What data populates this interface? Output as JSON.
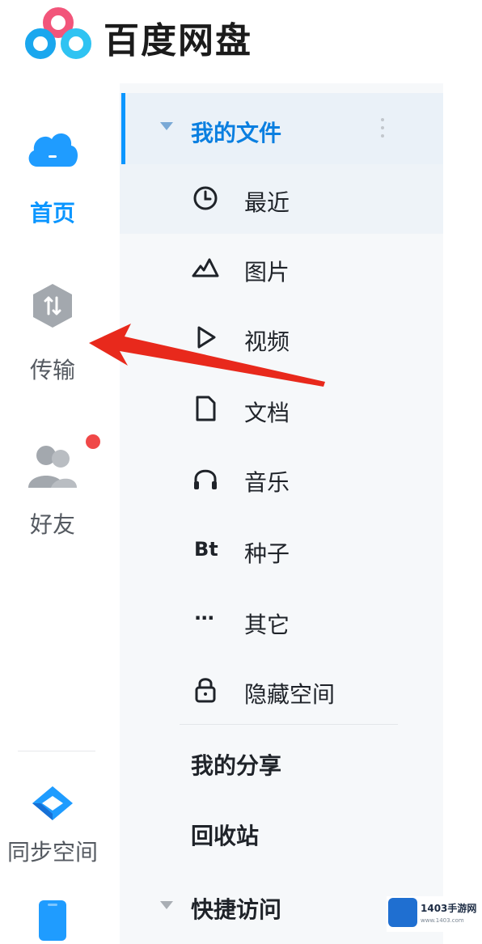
{
  "app": {
    "title": "百度网盘"
  },
  "rail": {
    "items": [
      {
        "label": "首页",
        "icon": "cloud-home-icon",
        "active": true
      },
      {
        "label": "传输",
        "icon": "transfer-icon",
        "active": false
      },
      {
        "label": "好友",
        "icon": "friends-icon",
        "active": false,
        "badge": "red-dot"
      },
      {
        "label": "同步空间",
        "icon": "sync-space-icon",
        "active": false
      },
      {
        "label": "",
        "icon": "phone-icon",
        "active": false
      }
    ]
  },
  "panel": {
    "my_files": {
      "label": "我的文件",
      "expanded": true
    },
    "categories": [
      {
        "label": "最近",
        "icon": "clock-icon"
      },
      {
        "label": "图片",
        "icon": "mountain-icon"
      },
      {
        "label": "视频",
        "icon": "play-icon"
      },
      {
        "label": "文档",
        "icon": "document-icon"
      },
      {
        "label": "音乐",
        "icon": "headphones-icon"
      },
      {
        "label": "种子",
        "icon": "bt-icon",
        "icon_text": "Bt"
      },
      {
        "label": "其它",
        "icon": "more-dots-icon",
        "icon_text": "···"
      },
      {
        "label": "隐藏空间",
        "icon": "lock-icon"
      }
    ],
    "my_share": "我的分享",
    "recycle_bin": "回收站",
    "quick_access": "快捷访问"
  },
  "watermark": {
    "text": "1403手游网",
    "sub": "www.1403.com"
  },
  "colors": {
    "accent": "#0b96ff",
    "arrow": "#e8291c",
    "badge": "#f04848"
  }
}
